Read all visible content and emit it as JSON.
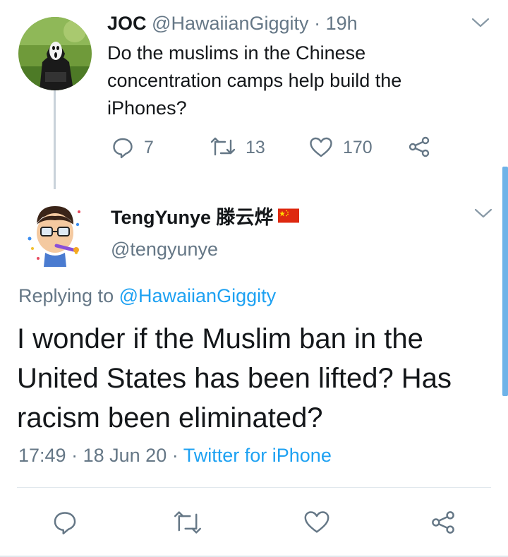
{
  "tweet1": {
    "display_name": "JOC",
    "handle": "@HawaiianGiggity",
    "separator": "·",
    "time": "19h",
    "text": "Do the muslims in the Chinese concentration camps help build the iPhones?",
    "replies": "7",
    "retweets": "13",
    "likes": "170"
  },
  "tweet2": {
    "display_name": "TengYunye 滕云烨",
    "flag_icon": "china-flag-icon",
    "handle": "@tengyunye",
    "replying_prefix": "Replying to",
    "replying_to": "@HawaiianGiggity",
    "text": "I wonder if the Muslim ban in the United States has been lifted? Has racism been eliminated?",
    "time": "17:49",
    "separator": "·",
    "date": "18 Jun 20",
    "source": "Twitter for iPhone"
  },
  "colors": {
    "accent": "#1da1f2",
    "secondary_text": "#657786",
    "primary_text": "#14171a",
    "flag_red": "#de2910",
    "flag_yellow": "#ffde00"
  }
}
